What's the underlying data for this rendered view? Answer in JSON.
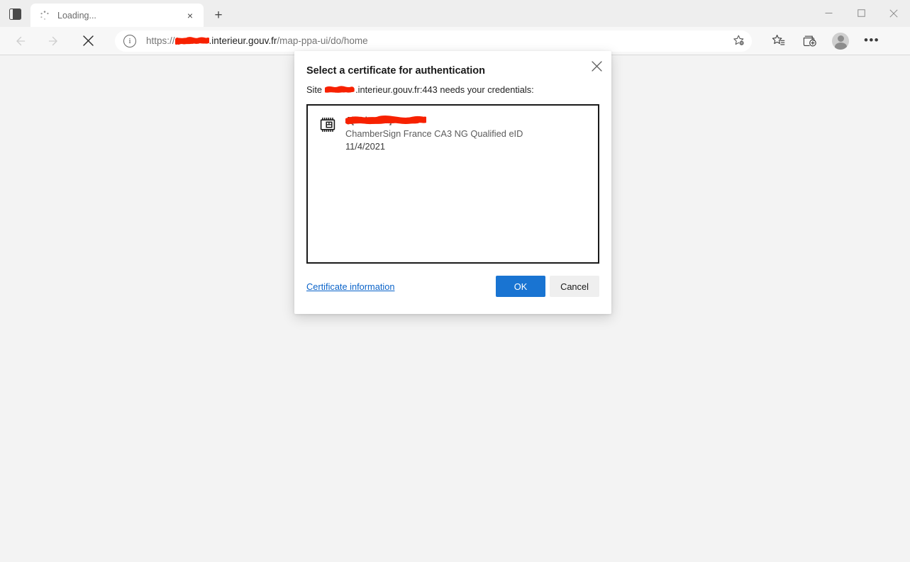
{
  "window": {
    "minimize_label": "Minimize",
    "maximize_label": "Maximize",
    "close_label": "Close"
  },
  "tabstrip": {
    "tab_actions_label": "Tab actions menu",
    "tab_title": "Loading...",
    "tab_close_label": "×",
    "new_tab_label": "+"
  },
  "toolbar": {
    "back_label": "Back",
    "forward_label": "Forward",
    "stop_label": "Stop loading",
    "url_scheme": "https://",
    "url_host_redacted": "[redacted]",
    "url_host": ".interieur.gouv.fr",
    "url_path": "/map-ppa-ui/do/home",
    "info_icon_glyph": "i",
    "add_favorite_label": "Add this page to favorites",
    "favorites_label": "Favorites",
    "collections_label": "Collections",
    "profile_label": "Profile",
    "settings_label": "Settings and more",
    "dots_glyph": "•••"
  },
  "dialog": {
    "title": "Select a certificate for authentication",
    "close_label": "Close",
    "subtitle_prefix": "Site",
    "subtitle_host_redacted": "[redacted]",
    "subtitle_suffix": ".interieur.gouv.fr:443 needs your credentials:",
    "certificates": [
      {
        "icon": "smartcard-chip-icon",
        "name_redacted": "A[redacted]",
        "issuer": "ChamberSign France CA3 NG Qualified eID",
        "valid_date": "11/4/2021"
      }
    ],
    "certificate_information_link": "Certificate information",
    "ok_label": "OK",
    "cancel_label": "Cancel"
  },
  "colors": {
    "accent_blue": "#1974d2",
    "link_blue": "#0a63c9",
    "redaction_red": "#f72100",
    "page_bg": "#f3f3f3",
    "chrome_bg": "#eeeeee",
    "toolbar_bg": "#f7f7f7"
  }
}
